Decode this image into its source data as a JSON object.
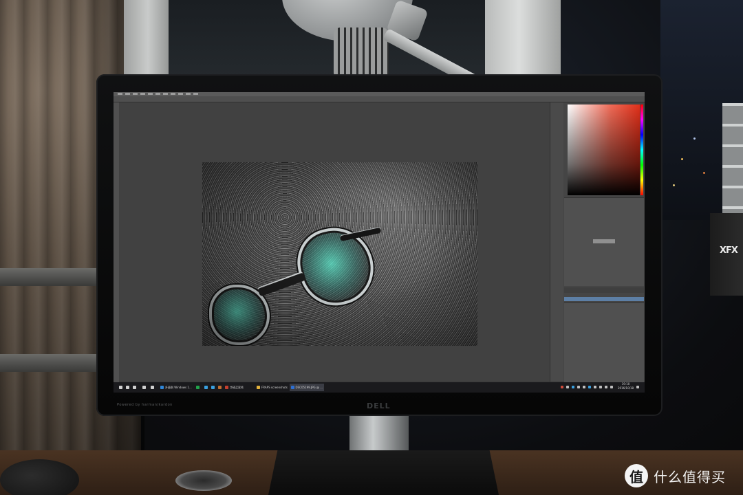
{
  "watermark": {
    "badge": "值",
    "text": "什么值得买"
  },
  "monitor": {
    "brand_left": "Powered by harman/kardon",
    "logo": "DELL"
  },
  "router": {
    "logo": "XFX"
  },
  "taskbar": {
    "items": [
      {
        "label": "",
        "icon_color": "#d0d0d0"
      },
      {
        "label": "",
        "icon_color": "#d0d0d0"
      },
      {
        "label": "",
        "icon_color": "#d0d0d0"
      },
      {
        "label": "",
        "icon_color": "#d0d0d0"
      },
      {
        "label": "",
        "icon_color": "#d0d0d0"
      },
      {
        "label": "升级到 Windows 1...",
        "icon_color": "#2f86d8"
      },
      {
        "label": "",
        "icon_color": "#21a34b"
      },
      {
        "label": "",
        "icon_color": "#3aa0e0"
      },
      {
        "label": "",
        "icon_color": "#3aa0e0"
      },
      {
        "label": "",
        "icon_color": "#c07030"
      },
      {
        "label": "华硕买家秀",
        "icon_color": "#c43f2f"
      },
      {
        "label": "FRAPS screenshots",
        "icon_color": "#e3b23c"
      },
      {
        "label": "DSC05199.JPG @ ...",
        "icon_color": "#2d6fd3"
      }
    ],
    "clock_time": "19:10",
    "clock_date": "2016/10/18"
  },
  "colors": {
    "screen_bg": "#3a3a3a",
    "ps_canvas": "#414141",
    "accent_layer": "#5d7fa5",
    "taskbar_bg": "#1a1a1d",
    "lens_tint": "#5aebcd"
  }
}
